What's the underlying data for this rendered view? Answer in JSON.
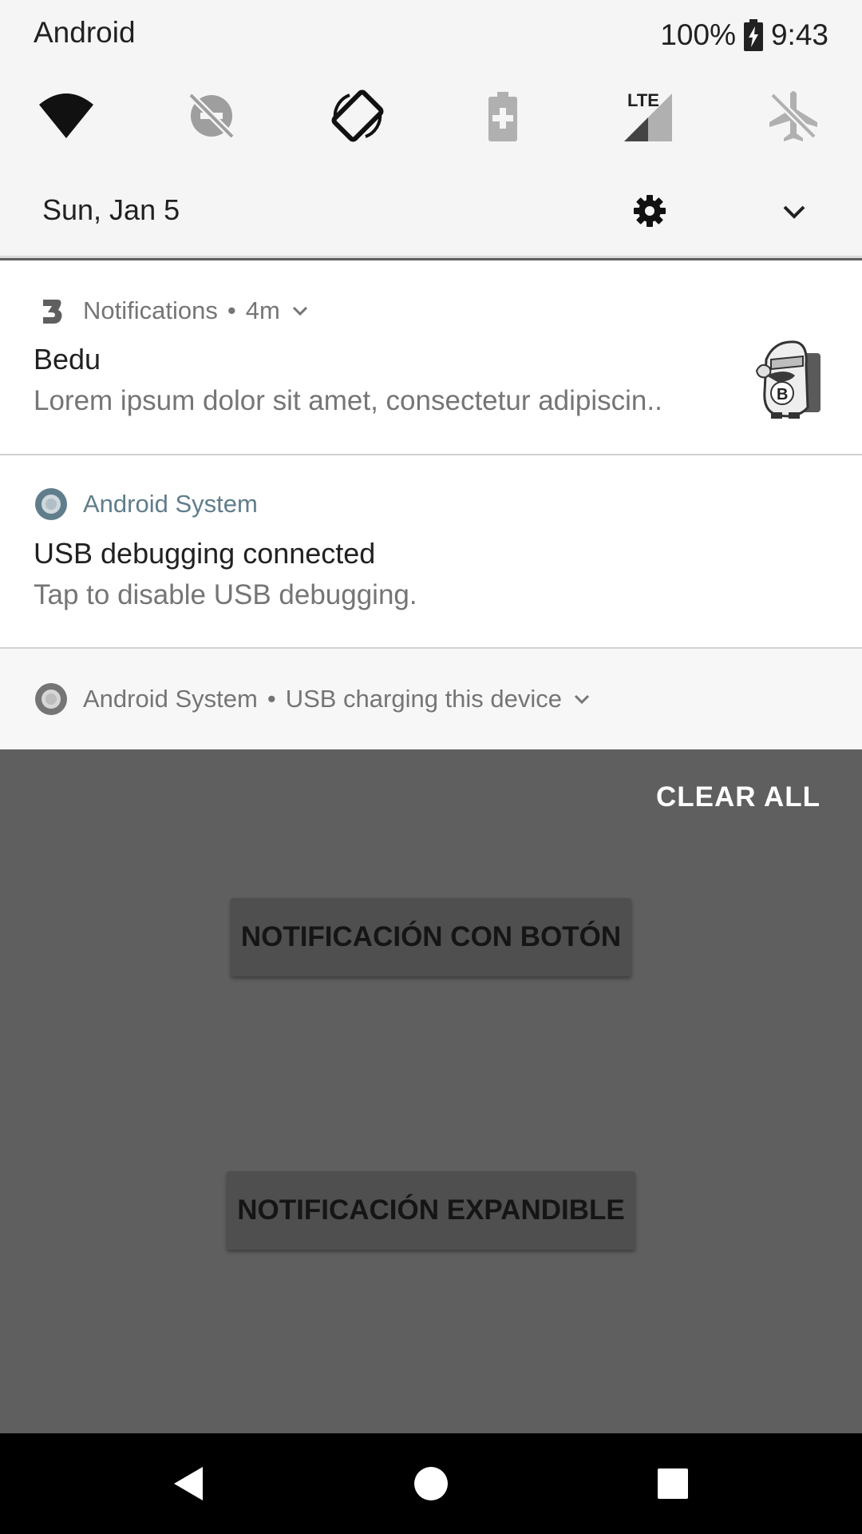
{
  "status_bar": {
    "carrier": "Android",
    "battery": "100%",
    "time": "9:43"
  },
  "quick_settings": {
    "tiles": [
      {
        "name": "wifi-icon"
      },
      {
        "name": "do-not-disturb-off-icon"
      },
      {
        "name": "auto-rotate-icon"
      },
      {
        "name": "battery-saver-icon"
      },
      {
        "name": "lte-signal-icon",
        "label": "LTE"
      },
      {
        "name": "airplane-mode-icon"
      }
    ],
    "date": "Sun, Jan 5"
  },
  "notifications": [
    {
      "app": "Notifications",
      "time": "4m",
      "title": "Bedu",
      "text": "Lorem ipsum dolor sit amet, consectetur adipiscin.."
    },
    {
      "app": "Android System",
      "title": "USB debugging connected",
      "text": "Tap to disable USB debugging."
    },
    {
      "app": "Android System",
      "summary": "USB charging this device"
    }
  ],
  "clear_all": "CLEAR ALL",
  "app_buttons": {
    "button1": "NOTIFICACIÓN CON BOTÓN",
    "button2": "NOTIFICACIÓN EXPANDIBLE"
  },
  "colors": {
    "shade_bg": "#f5f5f5",
    "scrim": "#5f5f5f",
    "accent": "#607d8b"
  }
}
